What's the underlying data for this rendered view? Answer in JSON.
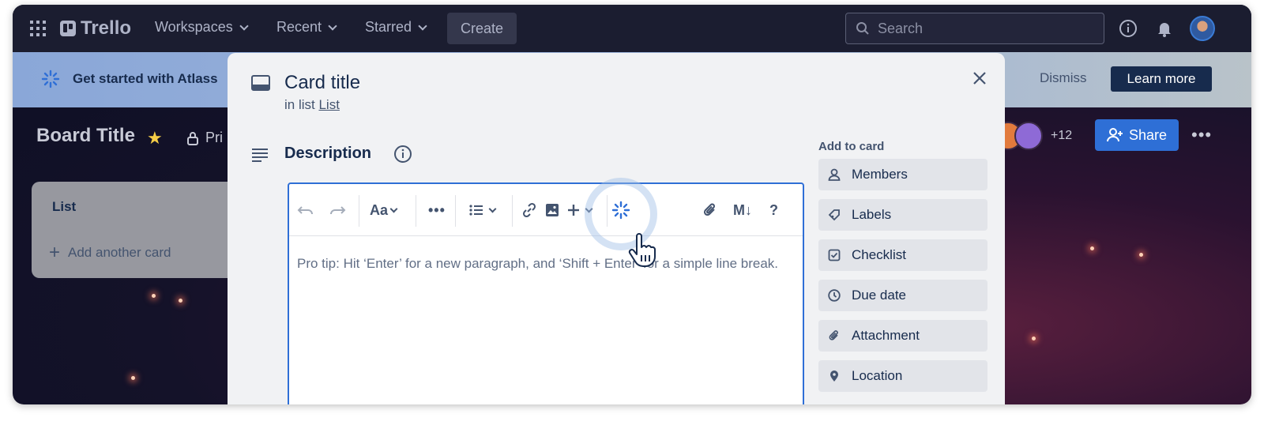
{
  "nav": {
    "brand": "Trello",
    "links": [
      "Workspaces",
      "Recent",
      "Starred"
    ],
    "create_label": "Create",
    "search_placeholder": "Search"
  },
  "banner": {
    "text": "Get started with Atlass",
    "dismiss_label": "Dismiss",
    "learn_more_label": "Learn more"
  },
  "board": {
    "title": "Board Title",
    "visibility": "Pri",
    "member_count": "+12",
    "share_label": "Share",
    "list": {
      "title": "List",
      "add_card_label": "Add another card"
    }
  },
  "modal": {
    "card_title": "Card title",
    "in_list_prefix": "in list",
    "in_list_link": "List",
    "description_title": "Description",
    "editor": {
      "text_style_label": "Aa",
      "markdown_label": "M↓",
      "help_label": "?",
      "body_text": "Pro tip: Hit ‘Enter’ for a new paragraph, and ‘Shift + Enter’ for a simple line break."
    },
    "sidebar": {
      "heading": "Add to card",
      "items": [
        {
          "label": "Members",
          "icon": "person-icon"
        },
        {
          "label": "Labels",
          "icon": "tag-icon"
        },
        {
          "label": "Checklist",
          "icon": "checkbox-icon"
        },
        {
          "label": "Due date",
          "icon": "clock-icon"
        },
        {
          "label": "Attachment",
          "icon": "paperclip-icon"
        },
        {
          "label": "Location",
          "icon": "pin-icon"
        }
      ]
    }
  },
  "colors": {
    "nav_bg": "#1b1d30",
    "accent_blue": "#2f6fd6",
    "modal_bg": "#f1f2f4",
    "star_yellow": "#f5cd47"
  }
}
